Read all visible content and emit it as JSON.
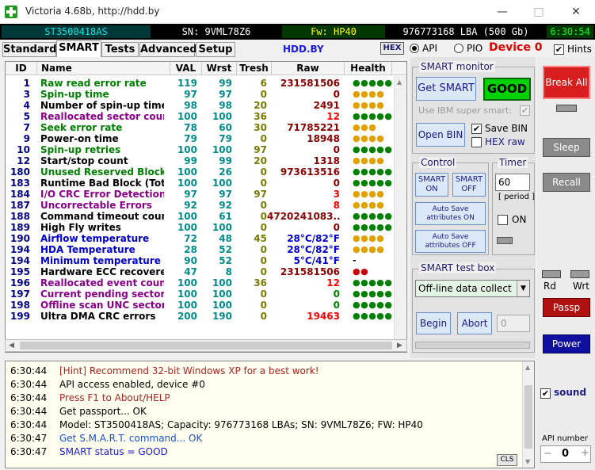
{
  "window": {
    "title": "Victoria 4.68b, http://hdd.by",
    "minimize": "—",
    "maximize": "□",
    "close": "✕"
  },
  "infobar": {
    "model": "ST3500418AS",
    "serial": "SN: 9VML78Z6",
    "firmware": "Fw: HP40",
    "capacity": "976773168 LBA (500 Gb)",
    "clock": "6:30:54"
  },
  "tabs": [
    "Standard",
    "SMART",
    "Tests",
    "Advanced",
    "Setup"
  ],
  "hdd_by": "HDD.BY",
  "hex_label": "HEX",
  "api_label": "API",
  "pio_label": "PIO",
  "device_label": "Device 0",
  "hints_label": "Hints",
  "table": {
    "headers": [
      "ID",
      "Name",
      "VAL",
      "Wrst",
      "Tresh",
      "Raw",
      "Health"
    ],
    "rows": [
      {
        "id": "1",
        "name": "Raw read error rate",
        "val": "119",
        "wrst": "99",
        "tresh": "6",
        "raw": "231581506",
        "health": "●●●●●",
        "name_color": "#008000",
        "raw_color": "#8b0000",
        "health_color": "#008000"
      },
      {
        "id": "3",
        "name": "Spin-up time",
        "val": "97",
        "wrst": "97",
        "tresh": "0",
        "raw": "0",
        "health": "●●●●",
        "name_color": "#008000",
        "raw_color": "#8b0000",
        "health_color": "#e0a000"
      },
      {
        "id": "4",
        "name": "Number of spin-up times",
        "val": "98",
        "wrst": "98",
        "tresh": "20",
        "raw": "2491",
        "health": "●●●●",
        "name_color": "#000000",
        "raw_color": "#8b0000",
        "health_color": "#e0a000"
      },
      {
        "id": "5",
        "name": "Reallocated sector count",
        "val": "100",
        "wrst": "100",
        "tresh": "36",
        "raw": "12",
        "health": "●●●●●",
        "name_color": "#8b008b",
        "raw_color": "#ff0000",
        "health_color": "#008000"
      },
      {
        "id": "7",
        "name": "Seek error rate",
        "val": "78",
        "wrst": "60",
        "tresh": "30",
        "raw": "71785221",
        "health": "●●●",
        "name_color": "#008000",
        "raw_color": "#8b0000",
        "health_color": "#e0a000"
      },
      {
        "id": "9",
        "name": "Power-on time",
        "val": "79",
        "wrst": "79",
        "tresh": "0",
        "raw": "18948",
        "health": "●●●●",
        "name_color": "#000000",
        "raw_color": "#8b0000",
        "health_color": "#e0a000"
      },
      {
        "id": "10",
        "name": "Spin-up retries",
        "val": "100",
        "wrst": "100",
        "tresh": "97",
        "raw": "0",
        "health": "●●●●●",
        "name_color": "#008000",
        "raw_color": "#8b0000",
        "health_color": "#008000"
      },
      {
        "id": "12",
        "name": "Start/stop count",
        "val": "99",
        "wrst": "99",
        "tresh": "20",
        "raw": "1318",
        "health": "●●●●",
        "name_color": "#000000",
        "raw_color": "#8b0000",
        "health_color": "#e0a000"
      },
      {
        "id": "180",
        "name": "Unused Reserved Block C...",
        "val": "100",
        "wrst": "26",
        "tresh": "0",
        "raw": "973613516",
        "health": "●●●●●",
        "name_color": "#008000",
        "raw_color": "#8b0000",
        "health_color": "#008000"
      },
      {
        "id": "183",
        "name": "Runtime Bad Block (Total)",
        "val": "100",
        "wrst": "100",
        "tresh": "0",
        "raw": "0",
        "health": "●●●●●",
        "name_color": "#000000",
        "raw_color": "#8b0000",
        "health_color": "#008000"
      },
      {
        "id": "184",
        "name": "I/O CRC Error Detection C...",
        "val": "97",
        "wrst": "97",
        "tresh": "97",
        "raw": "3",
        "health": "●●●●",
        "name_color": "#8b008b",
        "raw_color": "#ff0000",
        "health_color": "#e0a000"
      },
      {
        "id": "187",
        "name": "Uncorrectable Errors",
        "val": "92",
        "wrst": "92",
        "tresh": "0",
        "raw": "8",
        "health": "●●●●",
        "name_color": "#8b008b",
        "raw_color": "#ff0000",
        "health_color": "#e0a000"
      },
      {
        "id": "188",
        "name": "Command timeout count",
        "val": "100",
        "wrst": "61",
        "tresh": "0",
        "raw": "4720241083...",
        "health": "●●●●●",
        "name_color": "#000000",
        "raw_color": "#8b0000",
        "health_color": "#008000"
      },
      {
        "id": "189",
        "name": "High Fly writes",
        "val": "100",
        "wrst": "100",
        "tresh": "0",
        "raw": "0",
        "health": "●●●●●",
        "name_color": "#000000",
        "raw_color": "#8b0000",
        "health_color": "#008000"
      },
      {
        "id": "190",
        "name": "Airflow temperature",
        "val": "72",
        "wrst": "48",
        "tresh": "45",
        "raw": "28°C/82°F",
        "health": "●●●●",
        "name_color": "#0000cd",
        "raw_color": "#0000cd",
        "health_color": "#e0a000"
      },
      {
        "id": "194",
        "name": "HDA Temperature",
        "val": "28",
        "wrst": "52",
        "tresh": "0",
        "raw": "28°C/82°F",
        "health": "●●●●",
        "name_color": "#0000cd",
        "raw_color": "#0000cd",
        "health_color": "#e0a000"
      },
      {
        "id": "194",
        "name": "Minimum temperature",
        "val": "90",
        "wrst": "52",
        "tresh": "0",
        "raw": "5°C/41°F",
        "health": "-",
        "name_color": "#0000cd",
        "raw_color": "#0000cd",
        "health_color": "#000000"
      },
      {
        "id": "195",
        "name": "Hardware ECC recovered",
        "val": "47",
        "wrst": "8",
        "tresh": "0",
        "raw": "231581506",
        "health": "●●",
        "name_color": "#000000",
        "raw_color": "#8b0000",
        "health_color": "#cc0000"
      },
      {
        "id": "196",
        "name": "Reallocated event count",
        "val": "100",
        "wrst": "100",
        "tresh": "36",
        "raw": "12",
        "health": "●●●●●",
        "name_color": "#8b008b",
        "raw_color": "#ff0000",
        "health_color": "#008000"
      },
      {
        "id": "197",
        "name": "Current pending sectors",
        "val": "100",
        "wrst": "100",
        "tresh": "0",
        "raw": "0",
        "health": "●●●●●",
        "name_color": "#8b008b",
        "raw_color": "#008000",
        "health_color": "#008000"
      },
      {
        "id": "198",
        "name": "Offline scan UNC sectors",
        "val": "100",
        "wrst": "100",
        "tresh": "0",
        "raw": "0",
        "health": "●●●●●",
        "name_color": "#8b008b",
        "raw_color": "#008000",
        "health_color": "#008000"
      },
      {
        "id": "199",
        "name": "Ultra DMA CRC errors",
        "val": "200",
        "wrst": "190",
        "tresh": "0",
        "raw": "19463",
        "health": "●●●●●",
        "name_color": "#000000",
        "raw_color": "#ff0000",
        "health_color": "#008000"
      }
    ]
  },
  "smart_monitor": {
    "title": "SMART monitor",
    "get_smart": "Get SMART",
    "status": "GOOD",
    "ibm_label": "Use IBM super smart:",
    "open_bin": "Open BIN",
    "save_bin": "Save BIN",
    "hex_raw": "HEX raw"
  },
  "control": {
    "title": "Control",
    "smart_on": "SMART ON",
    "smart_off": "SMART OFF",
    "autosave_on": "Auto Save attributes ON",
    "autosave_off": "Auto Save attributes OFF"
  },
  "timer": {
    "title": "Timer",
    "value": "60",
    "period": "[ period ]",
    "on_label": "ON"
  },
  "smart_test": {
    "title": "SMART test box",
    "selected": "Off-line data collect",
    "begin": "Begin",
    "abort": "Abort",
    "value": "0"
  },
  "side": {
    "break_all": "Break All",
    "sleep": "Sleep",
    "recall": "Recall",
    "rd": "Rd",
    "wrt": "Wrt",
    "passp": "Passp",
    "power": "Power",
    "sound": "sound",
    "api_number_label": "API number",
    "api_number": "0"
  },
  "log": {
    "cls": "CLS",
    "entries": [
      {
        "time": "6:30:44",
        "msg": "[Hint] Recommend 32-bit Windows XP for a best work!",
        "color": "#b22222"
      },
      {
        "time": "6:30:44",
        "msg": "API access enabled, device #0",
        "color": "#000000"
      },
      {
        "time": "6:30:44",
        "msg": "Press F1 to About/HELP",
        "color": "#b22222"
      },
      {
        "time": "6:30:44",
        "msg": "Get passport... OK",
        "color": "#000000"
      },
      {
        "time": "6:30:44",
        "msg": "Model: ST3500418AS; Capacity: 976773168 LBAs; SN: 9VML78Z6; FW: HP40",
        "color": "#000000"
      },
      {
        "time": "6:30:47",
        "msg": "Get S.M.A.R.T. command... OK",
        "color": "#1a4fd8"
      },
      {
        "time": "6:30:47",
        "msg": "SMART status = GOOD",
        "color": "#1a1acd"
      }
    ]
  }
}
